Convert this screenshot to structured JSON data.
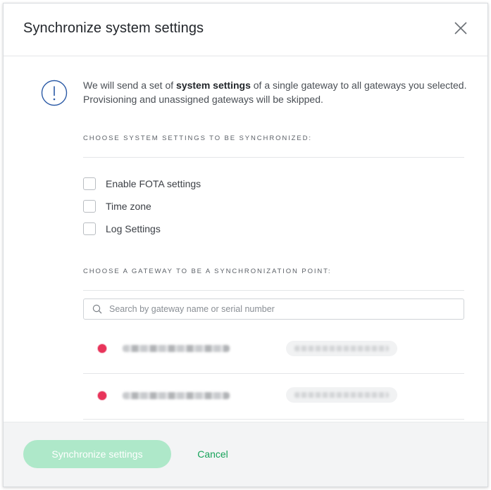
{
  "dialog": {
    "title": "Synchronize system settings",
    "close_icon": "close-icon"
  },
  "info": {
    "icon": "exclamation-circle-icon",
    "text_before": "We will send a set of ",
    "text_bold": "system settings",
    "text_after": " of a single gateway to all gateways you selected. Provisioning and unassigned gateways will be skipped."
  },
  "settings_section": {
    "label": "CHOOSE SYSTEM SETTINGS TO BE SYNCHRONIZED:",
    "options": [
      {
        "label": "Enable FOTA settings",
        "checked": false
      },
      {
        "label": "Time zone",
        "checked": false
      },
      {
        "label": "Log Settings",
        "checked": false
      }
    ]
  },
  "gateway_section": {
    "label": "CHOOSE A GATEWAY TO BE A SYNCHRONIZATION POINT:",
    "search": {
      "placeholder": "Search by gateway name or serial number",
      "value": "",
      "icon": "search-icon"
    },
    "gateways": [
      {
        "status": "offline",
        "status_color": "#e8345a"
      },
      {
        "status": "offline",
        "status_color": "#e8345a"
      }
    ]
  },
  "footer": {
    "sync_label": "Synchronize settings",
    "cancel_label": "Cancel"
  },
  "colors": {
    "accent_green": "#17a35a",
    "disabled_button": "#aee8c9",
    "status_red": "#e8345a",
    "info_blue": "#2b5aa6"
  }
}
